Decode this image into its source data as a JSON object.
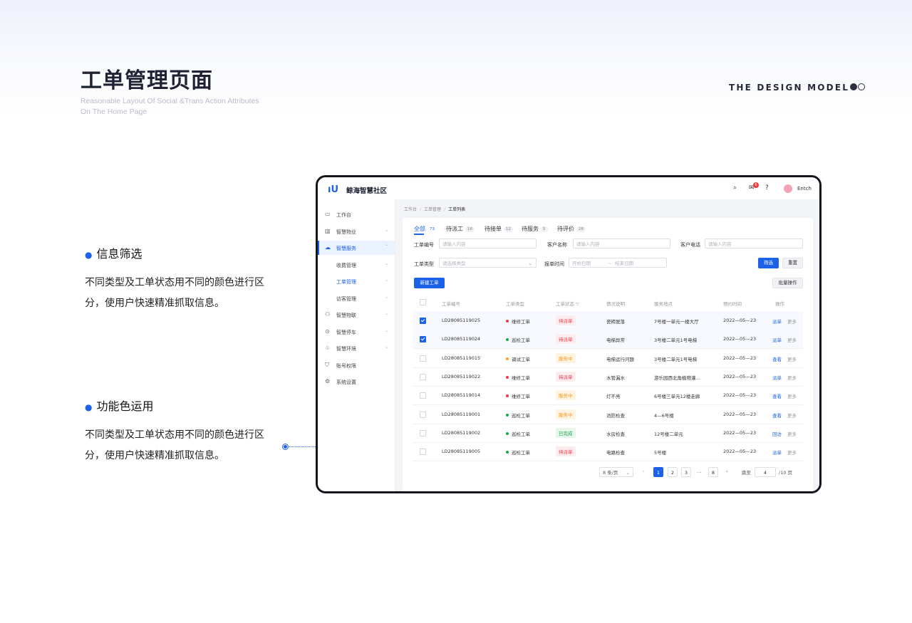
{
  "header": {
    "title": "工单管理页面",
    "subtitle_line1": "Reasonable Layout Of Social &Trans Action Attributes",
    "subtitle_line2": "On The Home Page",
    "brand": "THE DESIGN MODEL"
  },
  "notes": [
    {
      "title": "信息筛选",
      "text": "不同类型及工单状态用不同的颜色进行区分，使用户快速精准抓取信息。"
    },
    {
      "title": "功能色运用",
      "text": "不同类型及工单状态用不同的颜色进行区分，使用户快速精准抓取信息。"
    }
  ],
  "app": {
    "name": "鲸海智慧社区",
    "badge_count": "6",
    "user_name": "Entch",
    "sidebar": [
      {
        "label": "工作台",
        "icon": "dashboard-icon"
      },
      {
        "label": "智慧物业",
        "icon": "building-icon"
      },
      {
        "label": "智慧服务",
        "icon": "cloud-icon"
      },
      {
        "label": "收费管理"
      },
      {
        "label": "工单管理"
      },
      {
        "label": "访客管理"
      },
      {
        "label": "智慧物联",
        "icon": "devices-icon"
      },
      {
        "label": "智慧停车",
        "icon": "location-icon"
      },
      {
        "label": "智慧环境",
        "icon": "leaf-icon"
      },
      {
        "label": "账号权限",
        "icon": "shield-icon"
      },
      {
        "label": "系统设置",
        "icon": "gear-icon"
      }
    ],
    "breadcrumb": [
      "工作台",
      "工单管理",
      "工单列表"
    ],
    "tabs": [
      {
        "label": "全部",
        "count": "73"
      },
      {
        "label": "待派工",
        "count": "16"
      },
      {
        "label": "待接单",
        "count": "12"
      },
      {
        "label": "待服务",
        "count": "5"
      },
      {
        "label": "待评价",
        "count": "28"
      }
    ],
    "filters": {
      "order_no_label": "工单编号",
      "order_no_placeholder": "请输入内容",
      "customer_label": "客户名称",
      "customer_placeholder": "请输入内容",
      "phone_label": "客户电话",
      "phone_placeholder": "请输入内容",
      "type_label": "工单类型",
      "type_placeholder": "请选择类型",
      "time_label": "报单时间",
      "start_placeholder": "开始日期",
      "end_placeholder": "结束日期",
      "filter_button": "筛选",
      "reset_button": "重置"
    },
    "new_button": "新建工单",
    "batch_button": "批量操作",
    "columns": [
      "工单编号",
      "工单类型",
      "工单状态",
      "情况说明",
      "服务地点",
      "预约时间",
      "操作"
    ],
    "rows": [
      {
        "no": "LD28085119025",
        "type": "维修工单",
        "type_color": "#f0384a",
        "status": "待派单",
        "status_kind": "red",
        "desc": "瓷砖脱落",
        "place": "7号楼一单元一楼大厅",
        "time": "2022—05—23",
        "action": "派单",
        "more": "更多",
        "checked": true
      },
      {
        "no": "LD28085119024",
        "type": "巡检工单",
        "type_color": "#1aa84a",
        "status": "待派单",
        "status_kind": "red",
        "desc": "电梯异常",
        "place": "3号楼二单元1号电梯",
        "time": "2022—05—23",
        "action": "派单",
        "more": "更多",
        "checked": true
      },
      {
        "no": "LD28085119015",
        "type": "调试工单",
        "type_color": "#f5a623",
        "status": "服务中",
        "status_kind": "orange",
        "desc": "电梯运行问题",
        "place": "3号楼二单元1号电梯",
        "time": "2022—05—23",
        "action": "查看",
        "more": "更多",
        "checked": false
      },
      {
        "no": "LD28085119022",
        "type": "维修工单",
        "type_color": "#f0384a",
        "status": "待派单",
        "status_kind": "red",
        "desc": "水管漏水",
        "place": "游乐园西北角植物灌…",
        "time": "2022—05—23",
        "action": "派单",
        "more": "更多",
        "checked": false
      },
      {
        "no": "LD28085119014",
        "type": "维修工单",
        "type_color": "#f0384a",
        "status": "服务中",
        "status_kind": "orange",
        "desc": "灯不亮",
        "place": "6号楼三单元12楼走廊",
        "time": "2022—05—23",
        "action": "查看",
        "more": "更多",
        "checked": false
      },
      {
        "no": "LD28085119001",
        "type": "巡检工单",
        "type_color": "#1aa84a",
        "status": "服务中",
        "status_kind": "orange",
        "desc": "消防检查",
        "place": "4—6号楼",
        "time": "2022—05—23",
        "action": "查看",
        "more": "更多",
        "checked": false
      },
      {
        "no": "LD28085119002",
        "type": "巡检工单",
        "type_color": "#1aa84a",
        "status": "已完成",
        "status_kind": "green",
        "desc": "水房检查",
        "place": "12号楼二单元",
        "time": "2022—05—23",
        "action": "回访",
        "more": "更多",
        "checked": false
      },
      {
        "no": "LD28085119005",
        "type": "巡检工单",
        "type_color": "#1aa84a",
        "status": "待派单",
        "status_kind": "red",
        "desc": "电路检查",
        "place": "5号楼",
        "time": "2022—05—23",
        "action": "派单",
        "more": "更多",
        "checked": false
      }
    ],
    "pagination": {
      "page_size": "8 条/页",
      "pages": [
        "1",
        "2",
        "3",
        "…",
        "8"
      ],
      "current": "1",
      "jump_label": "跳至",
      "jump_value": "4",
      "total_label": "/10 页"
    }
  },
  "colors": {
    "primary": "#1b62e8",
    "status_red_bg": "#fdecee",
    "status_red_fg": "#f0384a",
    "status_orange_bg": "#fff3e2",
    "status_orange_fg": "#f59a23",
    "status_green_bg": "#e6f7ea",
    "status_green_fg": "#1aa84a"
  }
}
